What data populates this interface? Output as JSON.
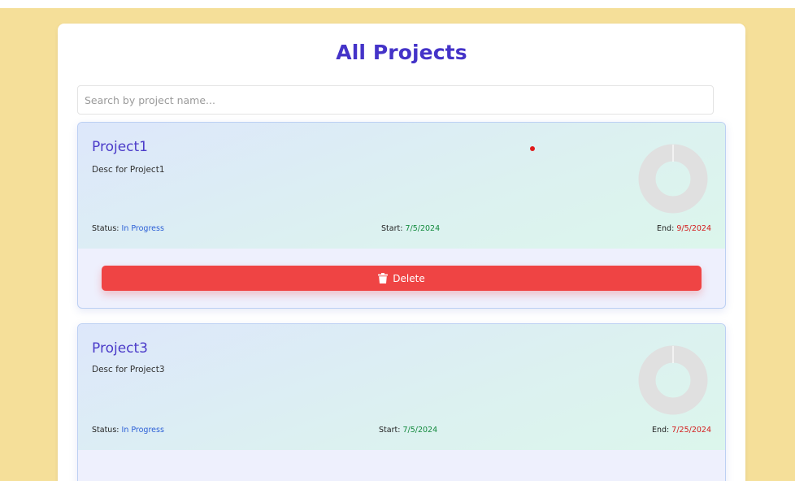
{
  "page": {
    "title": "All Projects"
  },
  "search": {
    "placeholder": "Search by project name...",
    "value": ""
  },
  "labels": {
    "status": "Status:",
    "start": "Start:",
    "end": "End:",
    "delete": "Delete"
  },
  "colors": {
    "background": "#f5df99",
    "title": "#4433c8",
    "status": "#2b5fd6",
    "start": "#138a3d",
    "end": "#d41c1c",
    "delete": "#ef4444",
    "donut": "#e0e0e0"
  },
  "icons": {
    "delete": "trash-icon",
    "progress": "donut-chart-icon"
  },
  "projects": [
    {
      "name": "Project1",
      "description": "Desc for Project1",
      "status": "In Progress",
      "start": "7/5/2024",
      "end": "9/5/2024"
    },
    {
      "name": "Project3",
      "description": "Desc for Project3",
      "status": "In Progress",
      "start": "7/5/2024",
      "end": "7/25/2024"
    }
  ]
}
